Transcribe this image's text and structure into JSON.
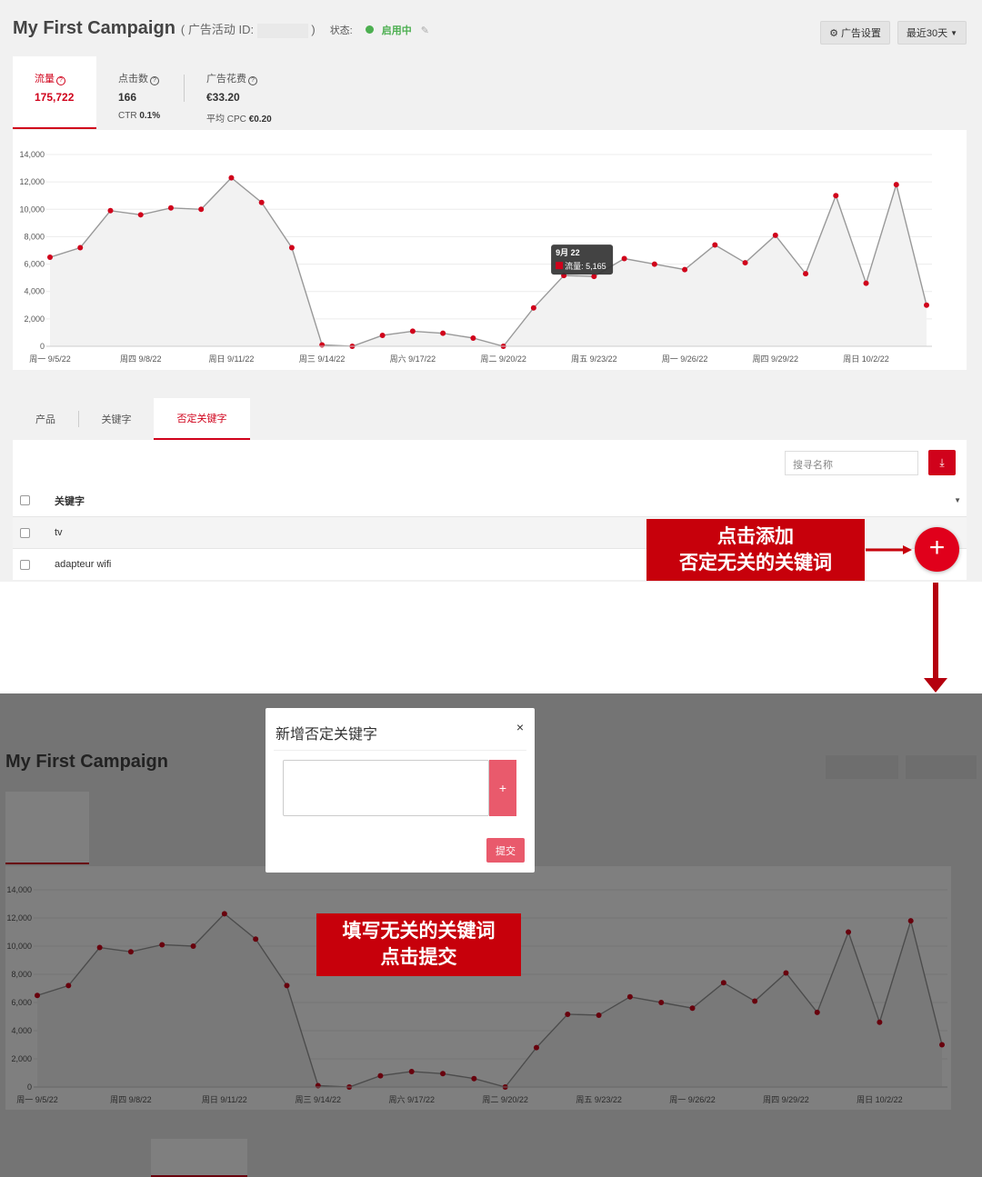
{
  "header": {
    "campaign_name": "My First Campaign",
    "campaign_id_label": "( 广告活动 ID:",
    "campaign_id_close": ")",
    "status_label": "状态:",
    "status_value": "启用中",
    "settings_button": "广告设置",
    "date_range_button": "最近30天"
  },
  "metrics": [
    {
      "label": "流量",
      "value": "175,722",
      "sub_label": "",
      "sub_value": ""
    },
    {
      "label": "点击数",
      "value": "166",
      "sub_label": "CTR",
      "sub_value": "0.1%"
    },
    {
      "label": "广告花费",
      "value": "€33.20",
      "sub_label": "平均 CPC",
      "sub_value": "€0.20"
    }
  ],
  "chart_data": {
    "type": "area",
    "series": [
      {
        "name": "流量",
        "values": [
          6500,
          7200,
          9900,
          9600,
          10100,
          10000,
          12300,
          10500,
          7200,
          100,
          0,
          800,
          1100,
          950,
          600,
          0,
          2800,
          5165,
          5100,
          6400,
          6000,
          5600,
          7400,
          6100,
          8100,
          5300,
          11000,
          4600,
          11800,
          3000
        ]
      }
    ],
    "x": [
      "9/5/22",
      "9/6/22",
      "9/7/22",
      "9/8/22",
      "9/9/22",
      "9/10/22",
      "9/11/22",
      "9/12/22",
      "9/13/22",
      "9/14/22",
      "9/15/22",
      "9/16/22",
      "9/17/22",
      "9/18/22",
      "9/19/22",
      "9/20/22",
      "9/21/22",
      "9/22/22",
      "9/23/22",
      "9/24/22",
      "9/25/22",
      "9/26/22",
      "9/27/22",
      "9/28/22",
      "9/29/22",
      "9/30/22",
      "10/1/22",
      "10/2/22",
      "10/3/22",
      "10/4/22"
    ],
    "x_tick_labels": [
      "周一 9/5/22",
      "周四 9/8/22",
      "周日 9/11/22",
      "周三 9/14/22",
      "周六 9/17/22",
      "周二 9/20/22",
      "周五 9/23/22",
      "周一 9/26/22",
      "周四 9/29/22",
      "周日 10/2/22"
    ],
    "y_tick_labels": [
      "0",
      "2,000",
      "4,000",
      "6,000",
      "8,000",
      "10,000",
      "12,000",
      "14,000"
    ],
    "ylim": [
      0,
      14000
    ],
    "grid": true,
    "colors": {
      "line": "#999999",
      "point": "#d0021b",
      "fill": "#f2f2f2"
    },
    "tooltip": {
      "title": "9月 22",
      "series_label": "流量",
      "value": "5,165"
    }
  },
  "tabs": [
    "产品",
    "关键字",
    "否定关键字"
  ],
  "active_tab": 2,
  "table": {
    "search_placeholder": "搜寻名称",
    "column_header": "关键字",
    "rows": [
      "tv",
      "adapteur wifi"
    ]
  },
  "annotations": {
    "callout_add_line1": "点击添加",
    "callout_add_line2": "否定无关的关键词",
    "callout_submit_line1": "填写无关的关键词",
    "callout_submit_line2": "点击提交",
    "add_button_symbol": "+"
  },
  "modal": {
    "title": "新增否定关键字",
    "close_symbol": "×",
    "plus_symbol": "+",
    "submit_label": "提交",
    "input_value": ""
  },
  "icons": {
    "settings": "gear-icon",
    "caret": "caret-down-icon",
    "download": "download-icon",
    "edit": "pencil-icon",
    "help": "question-circle-icon"
  },
  "colors": {
    "accent": "#d0021b",
    "status": "#4caf50",
    "callout": "#c7000b",
    "modal_button": "#e95a6c"
  }
}
